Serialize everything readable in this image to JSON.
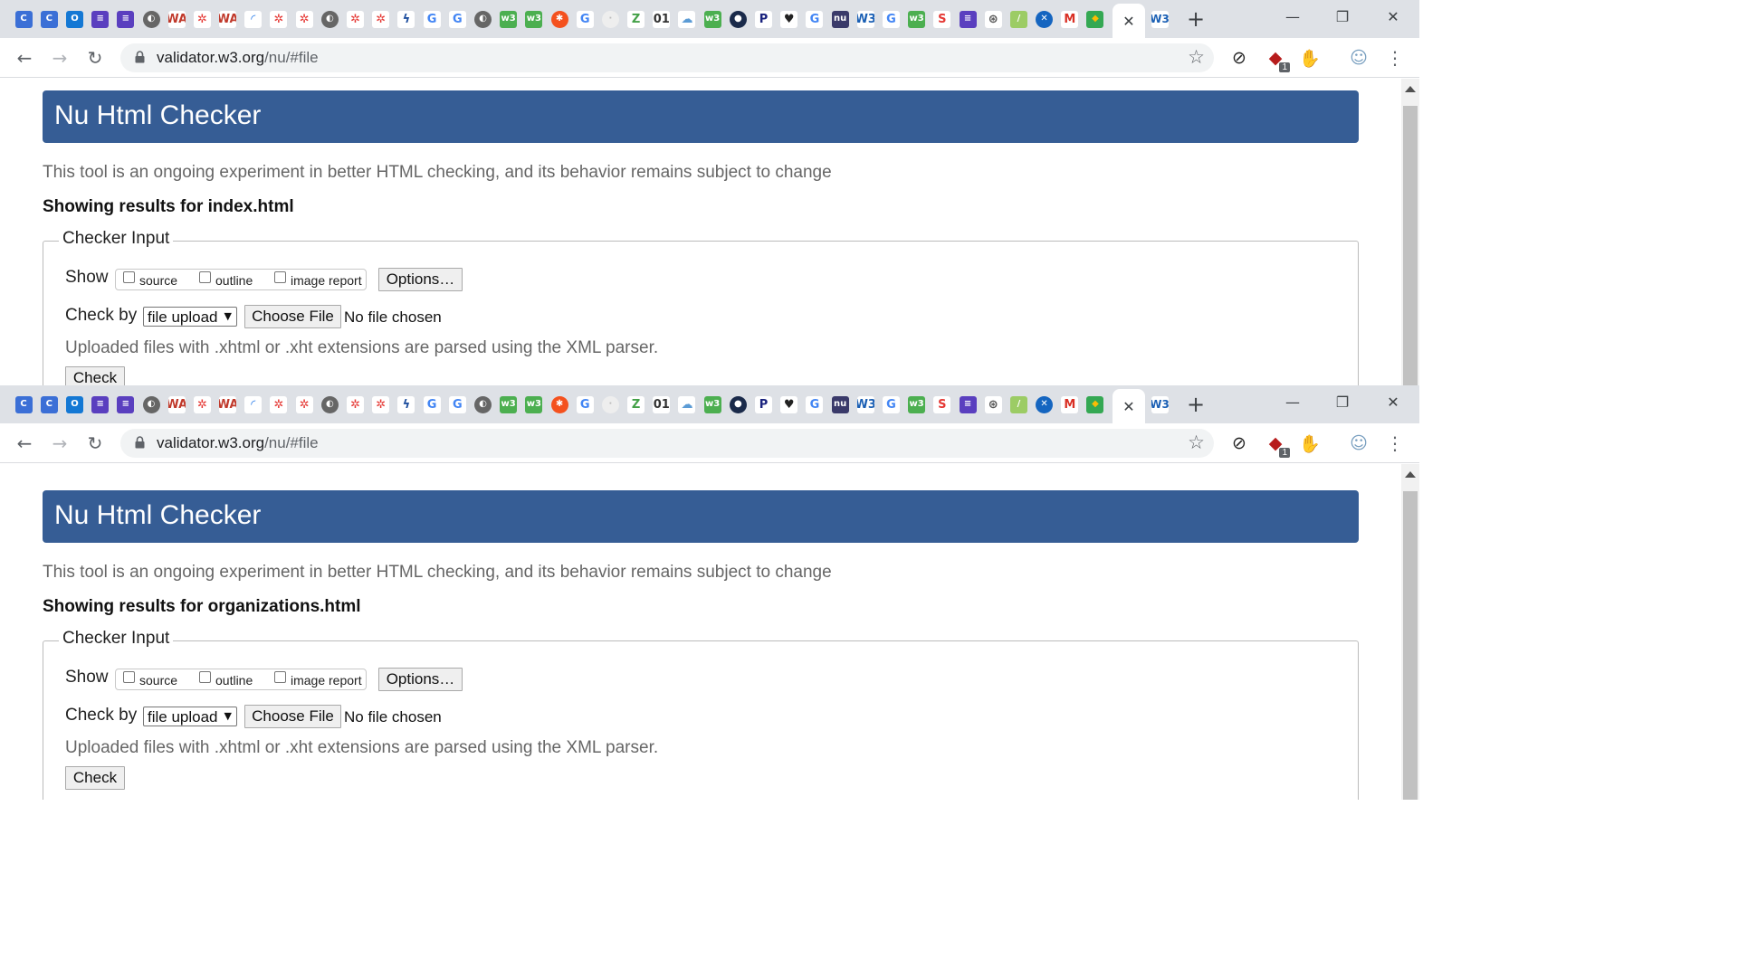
{
  "browser": {
    "tab_favicons": [
      {
        "icon": "c-app-icon",
        "glyph": "C",
        "bg": "#3b6fd6",
        "fg": "#ffffff"
      },
      {
        "icon": "c-app-icon",
        "glyph": "C",
        "bg": "#3b6fd6",
        "fg": "#ffffff"
      },
      {
        "icon": "outlook-icon",
        "glyph": "O",
        "bg": "#1478d4",
        "fg": "#ffffff"
      },
      {
        "icon": "list-icon",
        "glyph": "≡",
        "bg": "#5a3fbf",
        "fg": "#ffffff"
      },
      {
        "icon": "list-icon",
        "glyph": "≡",
        "bg": "#5a3fbf",
        "fg": "#ffffff"
      },
      {
        "icon": "globe-icon",
        "glyph": "◐",
        "bg": "#666666",
        "fg": "#ffffff",
        "round": true
      },
      {
        "icon": "wa-icon",
        "glyph": "WA",
        "bg": "#ffffff",
        "fg": "#c0392b"
      },
      {
        "icon": "gear-icon",
        "glyph": "✲",
        "bg": "#ffffff",
        "fg": "#e53935"
      },
      {
        "icon": "wa-icon",
        "glyph": "WA",
        "bg": "#ffffff",
        "fg": "#c0392b"
      },
      {
        "icon": "loading-icon",
        "glyph": "◜",
        "bg": "#ffffff",
        "fg": "#1a73e8"
      },
      {
        "icon": "gear-icon",
        "glyph": "✲",
        "bg": "#ffffff",
        "fg": "#e53935"
      },
      {
        "icon": "gear-icon",
        "glyph": "✲",
        "bg": "#ffffff",
        "fg": "#e53935"
      },
      {
        "icon": "globe-icon",
        "glyph": "◐",
        "bg": "#666666",
        "fg": "#ffffff",
        "round": true
      },
      {
        "icon": "gear-icon",
        "glyph": "✲",
        "bg": "#ffffff",
        "fg": "#e53935"
      },
      {
        "icon": "gear-icon",
        "glyph": "✲",
        "bg": "#ffffff",
        "fg": "#e53935"
      },
      {
        "icon": "swirl-icon",
        "glyph": "ϟ",
        "bg": "#ffffff",
        "fg": "#1e4e9e"
      },
      {
        "icon": "google-icon",
        "glyph": "G",
        "bg": "#ffffff",
        "fg": "#4285f4"
      },
      {
        "icon": "google-icon",
        "glyph": "G",
        "bg": "#ffffff",
        "fg": "#4285f4"
      },
      {
        "icon": "globe-icon",
        "glyph": "◐",
        "bg": "#666666",
        "fg": "#ffffff",
        "round": true
      },
      {
        "icon": "w3-green-icon",
        "glyph": "w3",
        "bg": "#4caf50",
        "fg": "#ffffff"
      },
      {
        "icon": "w3-green-icon",
        "glyph": "w3",
        "bg": "#4caf50",
        "fg": "#ffffff"
      },
      {
        "icon": "asterisk-icon",
        "glyph": "✱",
        "bg": "#f4511e",
        "fg": "#ffffff",
        "round": true
      },
      {
        "icon": "google-icon",
        "glyph": "G",
        "bg": "#ffffff",
        "fg": "#4285f4"
      },
      {
        "icon": "blank-icon",
        "glyph": "·",
        "bg": "#eeeeee",
        "fg": "#bbbbbb",
        "round": true
      },
      {
        "icon": "z-icon",
        "glyph": "Z",
        "bg": "#ffffff",
        "fg": "#43a047"
      },
      {
        "icon": "binary-icon",
        "glyph": "01",
        "bg": "#ffffff",
        "fg": "#333333"
      },
      {
        "icon": "cloud-icon",
        "glyph": "☁",
        "bg": "#ffffff",
        "fg": "#5b9bd5"
      },
      {
        "icon": "w3-green-icon",
        "glyph": "w3",
        "bg": "#4caf50",
        "fg": "#ffffff"
      },
      {
        "icon": "eye-icon",
        "glyph": "●",
        "bg": "#1a2a4a",
        "fg": "#ffffff",
        "round": true
      },
      {
        "icon": "p-icon",
        "glyph": "P",
        "bg": "#ffffff",
        "fg": "#1a237e"
      },
      {
        "icon": "heart-icon",
        "glyph": "♥",
        "bg": "#ffffff",
        "fg": "#222222"
      },
      {
        "icon": "google-icon",
        "glyph": "G",
        "bg": "#ffffff",
        "fg": "#4285f4"
      },
      {
        "icon": "nu-icon",
        "glyph": "nu",
        "bg": "#3a3a6a",
        "fg": "#ffffff"
      },
      {
        "icon": "w3-icon",
        "glyph": "W3",
        "bg": "#ffffff",
        "fg": "#1a5fb4"
      },
      {
        "icon": "google-icon",
        "glyph": "G",
        "bg": "#ffffff",
        "fg": "#4285f4"
      },
      {
        "icon": "w3-green-icon",
        "glyph": "w3",
        "bg": "#4caf50",
        "fg": "#ffffff"
      },
      {
        "icon": "s-icon",
        "glyph": "S",
        "bg": "#ffffff",
        "fg": "#e53935"
      },
      {
        "icon": "list-icon",
        "glyph": "≡",
        "bg": "#5a3fbf",
        "fg": "#ffffff"
      },
      {
        "icon": "aperture-icon",
        "glyph": "⊛",
        "bg": "#ffffff",
        "fg": "#555555"
      },
      {
        "icon": "edit-icon",
        "glyph": "/",
        "bg": "#9ccc65",
        "fg": "#ffffff"
      },
      {
        "icon": "x-circle-icon",
        "glyph": "✕",
        "bg": "#1565c0",
        "fg": "#ffffff",
        "round": true
      },
      {
        "icon": "gmail-icon",
        "glyph": "M",
        "bg": "#ffffff",
        "fg": "#d93025"
      },
      {
        "icon": "maps-icon",
        "glyph": "◆",
        "bg": "#34a853",
        "fg": "#fbbc04"
      }
    ],
    "active_tab_icon": "close-icon",
    "active_tab_close": "✕",
    "next_tab": {
      "icon": "w3-icon",
      "glyph": "W3",
      "bg": "#ffffff",
      "fg": "#1a5fb4"
    },
    "new_tab": "+",
    "window_controls": {
      "minimize": "—",
      "maximize": "❐",
      "close": "✕"
    },
    "nav": {
      "back": "←",
      "forward": "→",
      "reload": "↻"
    },
    "url_host": "validator.w3.org",
    "url_path": "/nu/#file",
    "bookmark_star": "☆",
    "extensions": [
      {
        "icon": "link-extension-icon",
        "glyph": "⊘",
        "color": "#222222"
      },
      {
        "icon": "shield-extension-icon",
        "glyph": "◆",
        "color": "#b71c1c",
        "badge": "1"
      },
      {
        "icon": "stop-extension-icon",
        "glyph": "✋",
        "color": "#e53935"
      },
      {
        "icon": "profile-avatar-icon",
        "glyph": "☺",
        "color": "#7aa0c0"
      }
    ],
    "menu": "⋮"
  },
  "panes": [
    {
      "banner_title": "Nu Html Checker",
      "intro": "This tool is an ongoing experiment in better HTML checking, and its behavior remains subject to change",
      "showing": "Showing results for index.html",
      "legend": "Checker Input",
      "show_label": "Show",
      "opt_source": "source",
      "opt_outline": "outline",
      "opt_image_report": "image report",
      "options_button": "Options…",
      "checkby_label": "Check by",
      "checkby_value": "file upload",
      "choose_file": "Choose File",
      "no_file": "No file chosen",
      "note": "Uploaded files with .xhtml or .xht extensions are parsed using the XML parser.",
      "check_button": "Check"
    },
    {
      "banner_title": "Nu Html Checker",
      "intro": "This tool is an ongoing experiment in better HTML checking, and its behavior remains subject to change",
      "showing": "Showing results for organizations.html",
      "legend": "Checker Input",
      "show_label": "Show",
      "opt_source": "source",
      "opt_outline": "outline",
      "opt_image_report": "image report",
      "options_button": "Options…",
      "checkby_label": "Check by",
      "checkby_value": "file upload",
      "choose_file": "Choose File",
      "no_file": "No file chosen",
      "note": "Uploaded files with .xhtml or .xht extensions are parsed using the XML parser.",
      "check_button": "Check"
    }
  ]
}
